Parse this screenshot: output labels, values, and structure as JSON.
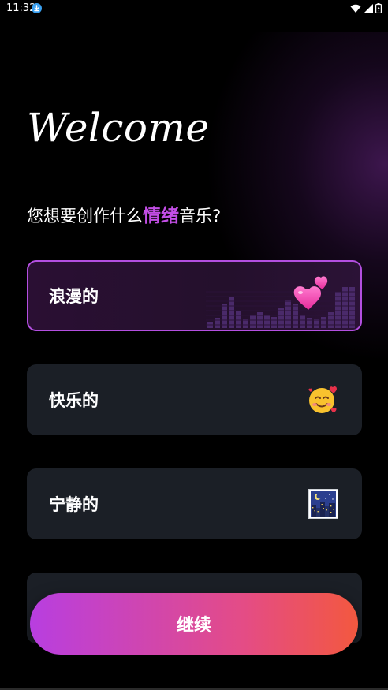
{
  "status_bar": {
    "time": "11:32"
  },
  "header": {
    "welcome": "Welcome",
    "prompt_before": "您想要创作什么",
    "prompt_highlight": "情绪",
    "prompt_after": "音乐?"
  },
  "options": [
    {
      "label": "浪漫的",
      "icon": "two-hearts-icon",
      "selected": true
    },
    {
      "label": "快乐的",
      "icon": "smiling-face-with-hearts-icon",
      "selected": false
    },
    {
      "label": "宁静的",
      "icon": "night-city-icon",
      "selected": false
    }
  ],
  "continue_label": "继续",
  "colors": {
    "accent": "#c34ee6",
    "card_bg": "#1b1f26",
    "button_gradient_start": "#b83ee0",
    "button_gradient_end": "#f3583f"
  }
}
